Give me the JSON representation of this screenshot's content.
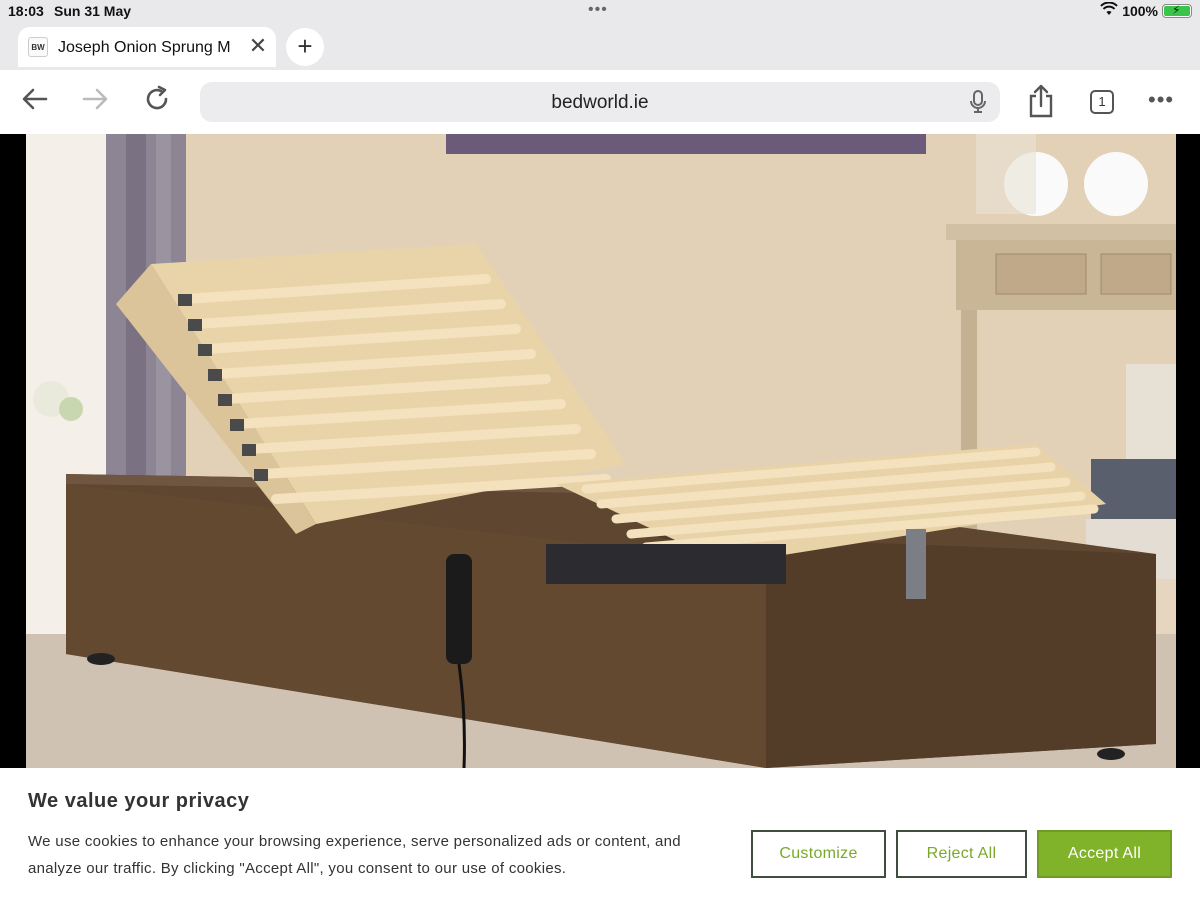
{
  "status_bar": {
    "time": "18:03",
    "date": "Sun 31 May",
    "battery_pct": "100%",
    "battery_level": 1.0
  },
  "tab": {
    "favicon_text": "BW",
    "title": "Joseph Onion Sprung M",
    "close_icon": "close-icon",
    "new_tab_symbol": "+"
  },
  "toolbar": {
    "url": "bedworld.ie",
    "tab_count": "1",
    "more_symbol": "•••"
  },
  "content": {
    "image_subject": "adjustable-bed-photo"
  },
  "cookie_banner": {
    "heading": "We value your privacy",
    "body": "We use cookies to enhance your browsing experience, serve personalized ads or content, and analyze our traffic. By clicking \"Accept All\", you consent to our use of cookies.",
    "customize_label": "Customize",
    "reject_label": "Reject All",
    "accept_label": "Accept All",
    "accent_color": "#80b22a"
  }
}
